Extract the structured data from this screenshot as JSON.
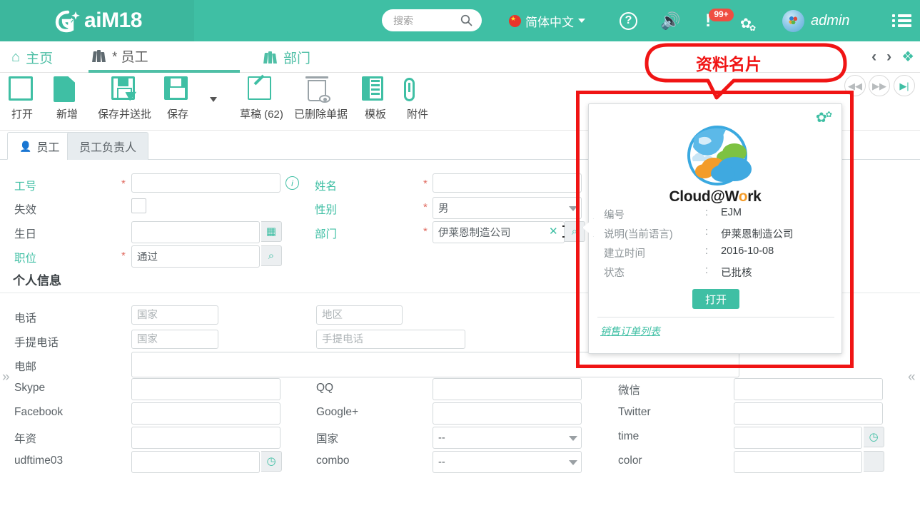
{
  "header": {
    "logo_text": "aiM18",
    "search_placeholder": "搜索",
    "search_value": "",
    "language": "简体中文",
    "notification_badge": "99+",
    "username": "admin",
    "icons": {
      "search": "search-icon",
      "flag": "china-flag-icon",
      "help": "help-icon",
      "sound": "sound-icon",
      "alert": "alert-icon",
      "settings": "gear-icon",
      "avatar": "user-avatar",
      "menu": "hamburger-menu-icon"
    }
  },
  "doc_tabs": [
    {
      "label": "主页",
      "icon": "home-icon",
      "active": false
    },
    {
      "label": "* 员工",
      "icon": "books-icon",
      "active": true
    },
    {
      "label": "部门",
      "icon": "books-icon",
      "active": false
    }
  ],
  "toolbar": {
    "buttons": [
      {
        "label": "打开",
        "icon": "open-icon"
      },
      {
        "label": "新增",
        "icon": "new-document-icon"
      },
      {
        "label": "保存并送批",
        "icon": "save-and-submit-icon"
      },
      {
        "label": "保存",
        "icon": "save-icon"
      },
      {
        "label": "草稿 (62)",
        "icon": "draft-edit-icon"
      },
      {
        "label": "已删除单据",
        "icon": "deleted-documents-icon"
      },
      {
        "label": "模板",
        "icon": "template-icon"
      },
      {
        "label": "附件",
        "icon": "attachment-icon"
      }
    ]
  },
  "sub_tabs": [
    {
      "label": "员工",
      "active": true
    },
    {
      "label": "员工负责人",
      "active": false
    }
  ],
  "form": {
    "section_title": "个人信息",
    "fields": {
      "staff_no": {
        "label": "工号",
        "value": "",
        "required": true
      },
      "invalid": {
        "label": "失效",
        "checked": false,
        "required": false
      },
      "birthday": {
        "label": "生日",
        "value": "",
        "required": false
      },
      "position": {
        "label": "职位",
        "value": "通过",
        "required": true
      },
      "name": {
        "label": "姓名",
        "value": "",
        "required": true
      },
      "gender": {
        "label": "性别",
        "value": "男",
        "required": true
      },
      "department": {
        "label": "部门",
        "value": "伊莱恩制造公司",
        "required": true
      },
      "phone": {
        "label": "电话",
        "country_placeholder": "国家",
        "area_placeholder": "地区"
      },
      "mobile": {
        "label": "手提电话",
        "country_placeholder": "国家",
        "number_placeholder": "手提电话"
      },
      "email": {
        "label": "电邮",
        "value": ""
      },
      "skype": {
        "label": "Skype",
        "value": ""
      },
      "qq": {
        "label": "QQ",
        "value": ""
      },
      "wechat": {
        "label": "微信",
        "value": ""
      },
      "facebook": {
        "label": "Facebook",
        "value": ""
      },
      "googleplus": {
        "label": "Google+",
        "value": ""
      },
      "twitter": {
        "label": "Twitter",
        "value": ""
      },
      "seniority": {
        "label": "年资",
        "value": ""
      },
      "country": {
        "label": "国家",
        "value": "--"
      },
      "time": {
        "label": "time",
        "value": ""
      },
      "udftime03": {
        "label": "udftime03",
        "value": ""
      },
      "combo": {
        "label": "combo",
        "value": "--"
      },
      "color": {
        "label": "color",
        "value": ""
      }
    }
  },
  "card": {
    "brand": "Cloud@Work",
    "rows": [
      {
        "key": "编号",
        "value": "EJM"
      },
      {
        "key": "说明(当前语言)",
        "value": "伊莱恩制造公司"
      },
      {
        "key": "建立时间",
        "value": "2016-10-08"
      },
      {
        "key": "状态",
        "value": "已批核"
      }
    ],
    "colon": ":",
    "open_button": "打开",
    "link": "销售订单列表"
  },
  "annotation": {
    "text": "资料名片",
    "color": "#f01414"
  },
  "colors": {
    "brand_teal": "#3fbfa4",
    "logo_block": "#3cb79d",
    "annotation_red": "#f01414",
    "required_star": "#e06a5f"
  }
}
